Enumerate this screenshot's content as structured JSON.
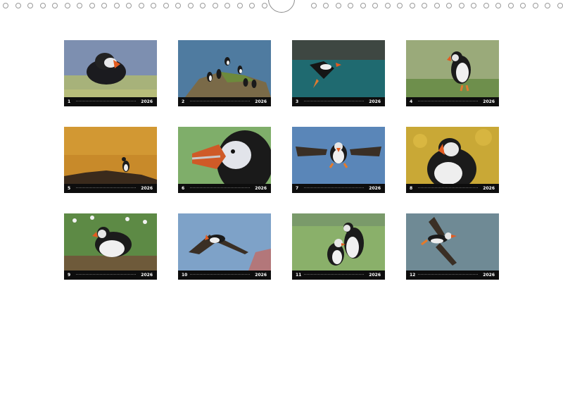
{
  "calendar": {
    "year": "2026",
    "months": [
      {
        "number": "1",
        "photo": "puffin-portrait-closeup"
      },
      {
        "number": "2",
        "photo": "puffins-on-rock-by-sea"
      },
      {
        "number": "3",
        "photo": "puffin-flying-over-water"
      },
      {
        "number": "4",
        "photo": "puffin-with-fish-on-grass"
      },
      {
        "number": "5",
        "photo": "puffin-on-ridge-golden-light"
      },
      {
        "number": "6",
        "photo": "puffin-head-closeup"
      },
      {
        "number": "7",
        "photo": "puffin-flying-toward-camera"
      },
      {
        "number": "8",
        "photo": "puffin-portrait-yellow-flowers"
      },
      {
        "number": "9",
        "photo": "puffin-in-meadow-with-fish"
      },
      {
        "number": "10",
        "photo": "puffin-flying-with-fish"
      },
      {
        "number": "11",
        "photo": "two-puffins-on-grass"
      },
      {
        "number": "12",
        "photo": "puffin-flying-wings-up"
      }
    ]
  },
  "colors": {
    "caption_bg": "#0d0d0d",
    "ring_stroke": "#9a9a9a"
  }
}
